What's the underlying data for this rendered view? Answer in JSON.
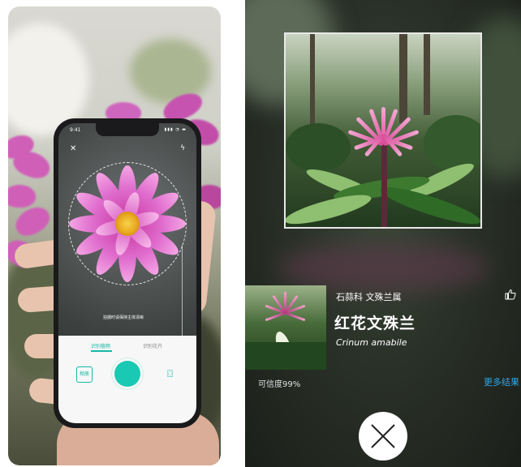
{
  "camera_screen": {
    "status_time": "9:41",
    "status_icons": "▮▮▮ ◔ ▬",
    "close_icon_glyph": "✕",
    "flash_icon_glyph": "ϟ",
    "hint_text": "拍摄时请保持主体清晰",
    "tab_active": "识别植物",
    "tab_inactive": "识别花卉",
    "album_label": "相册",
    "switch_camera_glyph": "⌼",
    "zoom_glyph": "+",
    "accent_color": "#19c9b3"
  },
  "result_screen": {
    "family_genus": "石蒜科 文殊兰属",
    "species_name": "红花文殊兰",
    "latin_name": "Crinum amabile",
    "confidence": "可信度99%",
    "more_results": "更多结果",
    "link_color": "#2fa9e5",
    "icons": [
      "thumbs-up-icon",
      "close-icon"
    ]
  }
}
